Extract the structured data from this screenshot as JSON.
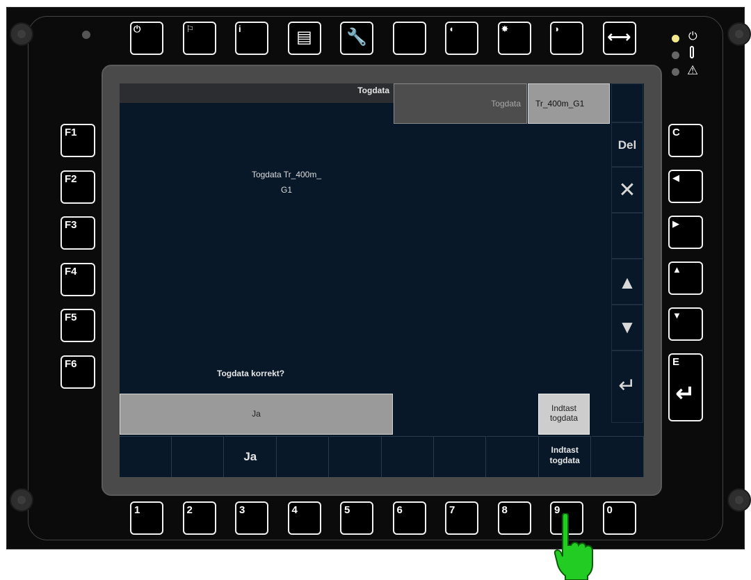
{
  "top_keys": [
    {
      "icon": "power-icon",
      "glyph": "⏻"
    },
    {
      "icon": "flag-icon",
      "glyph": "⚐"
    },
    {
      "icon": "info-icon",
      "glyph": "i"
    },
    {
      "icon": "document-icon",
      "glyph": "▤"
    },
    {
      "icon": "wrench-icon",
      "glyph": "🔧"
    },
    {
      "icon": "blank-icon",
      "glyph": ""
    },
    {
      "icon": "speaker-icon",
      "glyph": "◖"
    },
    {
      "icon": "brightness-icon",
      "glyph": "✸"
    },
    {
      "icon": "contrast-icon",
      "glyph": "◑"
    },
    {
      "icon": "expand-arrows-icon",
      "glyph": "⟷"
    }
  ],
  "left_keys": [
    "F1",
    "F2",
    "F3",
    "F4",
    "F5",
    "F6"
  ],
  "right_keys": [
    {
      "label": "C",
      "icon": "clear-icon"
    },
    {
      "label": "◀",
      "icon": "arrow-left-icon"
    },
    {
      "label": "▶",
      "icon": "arrow-right-icon"
    },
    {
      "label": "▲",
      "icon": "arrow-up-icon"
    },
    {
      "label": "▼",
      "icon": "arrow-down-icon"
    },
    {
      "label": "E",
      "icon": "enter-icon"
    }
  ],
  "bottom_keys": [
    "1",
    "2",
    "3",
    "4",
    "5",
    "6",
    "7",
    "8",
    "9",
    "0"
  ],
  "indicators": [
    {
      "icon": "power-icon",
      "color": "#f2e98a"
    },
    {
      "icon": "thermometer-icon",
      "color": "#666666"
    },
    {
      "icon": "warning-icon",
      "color": "#666666"
    }
  ],
  "screen": {
    "title": "Togdata",
    "tabs": {
      "active": "Togdata",
      "name": "Tr_400m_G1"
    },
    "message_line1": "Togdata Tr_400m_",
    "message_line2": "G1",
    "question": "Togdata korrekt?",
    "yes_button": "Ja",
    "enter_data_button": "Indtast togdata",
    "side_buttons": {
      "del": "Del",
      "close": "✕",
      "up": "▲",
      "down": "▼",
      "enter": "↵"
    },
    "softkeys": [
      "",
      "",
      "Ja",
      "",
      "",
      "",
      "",
      "",
      "Indtast togdata",
      ""
    ]
  },
  "colors": {
    "screen_bg": "#081828",
    "button_gray": "#9a9a9a",
    "pointer_green": "#22cc22"
  }
}
